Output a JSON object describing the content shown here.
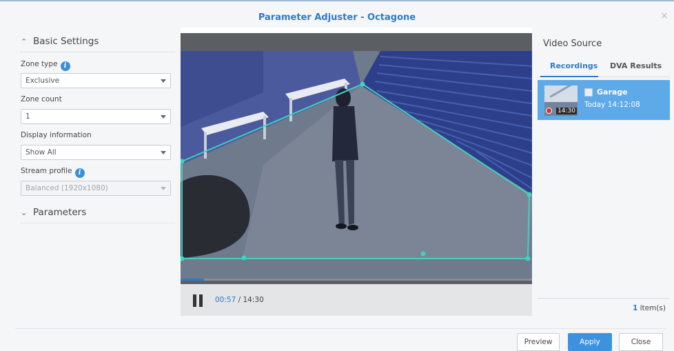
{
  "window": {
    "title": "Parameter Adjuster - Octagone",
    "close_glyph": "×"
  },
  "basic_settings": {
    "heading": "Basic Settings",
    "zone_type": {
      "label": "Zone type",
      "value": "Exclusive"
    },
    "zone_count": {
      "label": "Zone count",
      "value": "1"
    },
    "display_information": {
      "label": "Display information",
      "value": "Show All"
    },
    "stream_profile": {
      "label": "Stream profile",
      "value": "Balanced (1920x1080)",
      "disabled": true
    }
  },
  "parameters": {
    "heading": "Parameters"
  },
  "player": {
    "current_time": "00:57",
    "separator": " / ",
    "total_time": "14:30",
    "progress_fraction": 0.066
  },
  "video_source": {
    "title": "Video Source",
    "tabs": [
      {
        "label": "Recordings",
        "active": true
      },
      {
        "label": "DVA Results",
        "active": false
      }
    ],
    "recordings": [
      {
        "name": "Garage",
        "time": "Today 14:12:08",
        "duration": "14:30"
      }
    ],
    "count_number": "1",
    "count_suffix": " item(s)"
  },
  "footer": {
    "preview_label": "Preview",
    "apply_label": "Apply",
    "close_label": "Close"
  },
  "colors": {
    "accent": "#2f7bc7",
    "selection": "#5ea9e8",
    "zone_outline": "#3fd2c0"
  }
}
